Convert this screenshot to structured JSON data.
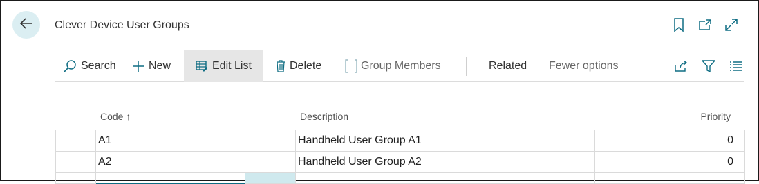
{
  "page": {
    "title": "Clever Device User Groups"
  },
  "toolbar": {
    "search": "Search",
    "new": "New",
    "edit_list": "Edit List",
    "delete": "Delete",
    "group_members": "Group Members",
    "related": "Related",
    "fewer_options": "Fewer options"
  },
  "columns": {
    "code": "Code",
    "code_sort": "↑",
    "description": "Description",
    "priority": "Priority"
  },
  "rows": [
    {
      "code": "A1",
      "description": "Handheld User Group A1",
      "priority": "0"
    },
    {
      "code": "A2",
      "description": "Handheld User Group A2",
      "priority": "0"
    }
  ],
  "colors": {
    "accent": "#0f6d83",
    "back_bg": "#dbeef2",
    "active_bg": "#e6e6e6"
  },
  "icons": [
    "back-arrow-icon",
    "bookmark-icon",
    "open-new-window-icon",
    "expand-icon",
    "search-icon",
    "plus-icon",
    "edit-list-icon",
    "trash-icon",
    "brackets-icon",
    "share-icon",
    "filter-icon",
    "list-view-icon"
  ]
}
